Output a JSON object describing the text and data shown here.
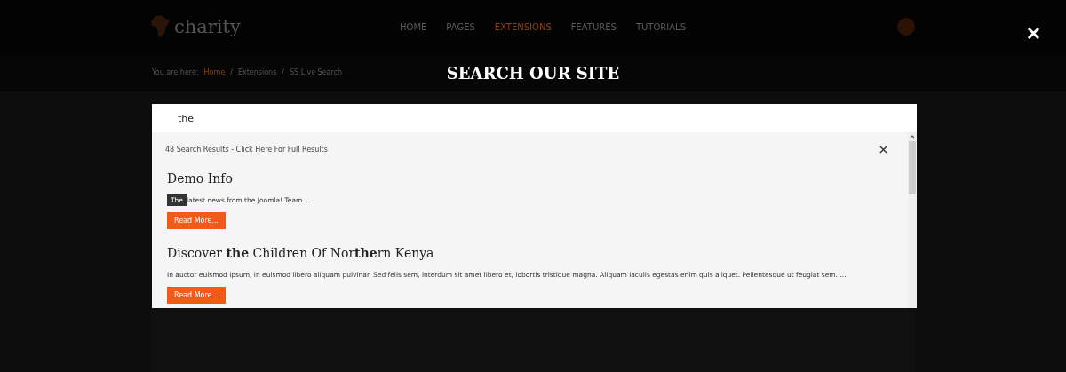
{
  "header": {
    "logo": "charity",
    "nav": [
      {
        "label": "HOME",
        "selected": false
      },
      {
        "label": "PAGES",
        "selected": false
      },
      {
        "label": "EXTENSIONS",
        "selected": true
      },
      {
        "label": "FEATURES",
        "selected": false
      },
      {
        "label": "TUTORIALS",
        "selected": false
      }
    ]
  },
  "breadcrumb": {
    "label": "You are here:",
    "items": [
      {
        "label": "Home",
        "link": true
      },
      {
        "label": "/",
        "link": false
      },
      {
        "label": "Extensions",
        "link": false
      },
      {
        "label": "/",
        "link": false
      },
      {
        "label": "SS Live Search",
        "link": false
      }
    ]
  },
  "overlay": {
    "title": "SEARCH OUR SITE",
    "query": "the",
    "summary": "48 Search Results - Click Here For Full Results",
    "results": [
      {
        "title": "Demo Info",
        "snippet": [
          {
            "text": "The",
            "highlighted": true
          },
          {
            "text": "latest news from the Joomla! Team  ...",
            "highlighted": false
          }
        ],
        "button": "Read More..."
      },
      {
        "title": "Discover **the** Children Of Nor**the**rn Kenya",
        "snippet": [
          {
            "text": "In auctor euismod ipsum, in euismod libero aliquam pulvinar. Sed felis sem, interdum sit amet libero et, lobortis tristique magna. Aliquam iaculis egestas enim quis aliquet. Pellentesque ut feugiat sem. ...",
            "highlighted": false
          }
        ],
        "button": "Read More..."
      }
    ]
  }
}
